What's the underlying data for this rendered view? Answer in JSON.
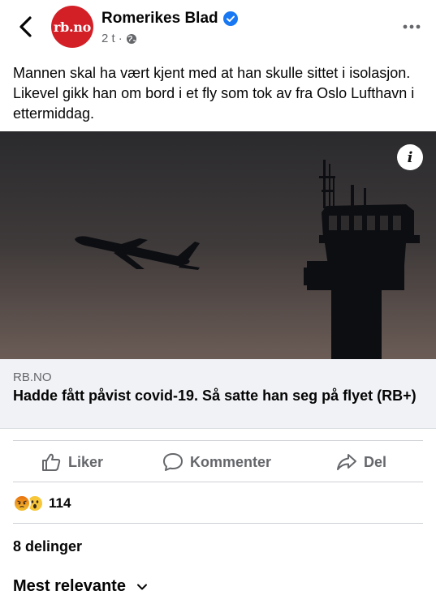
{
  "header": {
    "avatar_text": "rb.no",
    "page_name": "Romerikes Blad",
    "time": "2 t",
    "separator": "·",
    "icons": {
      "back": "chevron-left-icon",
      "verified": "verified-badge-icon",
      "audience": "globe-icon",
      "more": "more-horizontal-icon"
    },
    "colors": {
      "avatar": "#d32027",
      "verified": "#1877f2"
    }
  },
  "post": {
    "text": "Mannen skal ha vært kjent med at han skulle sittet i isolasjon. Likevel gikk han om bord i et fly som tok av fra Oslo Lufthavn i ettermiddag."
  },
  "photo": {
    "info_symbol": "i"
  },
  "link": {
    "domain": "RB.NO",
    "title": "Hadde fått påvist covid-19. Så satte han seg på flyet (RB+)"
  },
  "actions": {
    "like": "Liker",
    "comment": "Kommenter",
    "share": "Del"
  },
  "reactions": {
    "count": "114",
    "types": [
      "angry",
      "wow"
    ]
  },
  "shares": "8 delinger",
  "sort_label": "Mest relevante"
}
